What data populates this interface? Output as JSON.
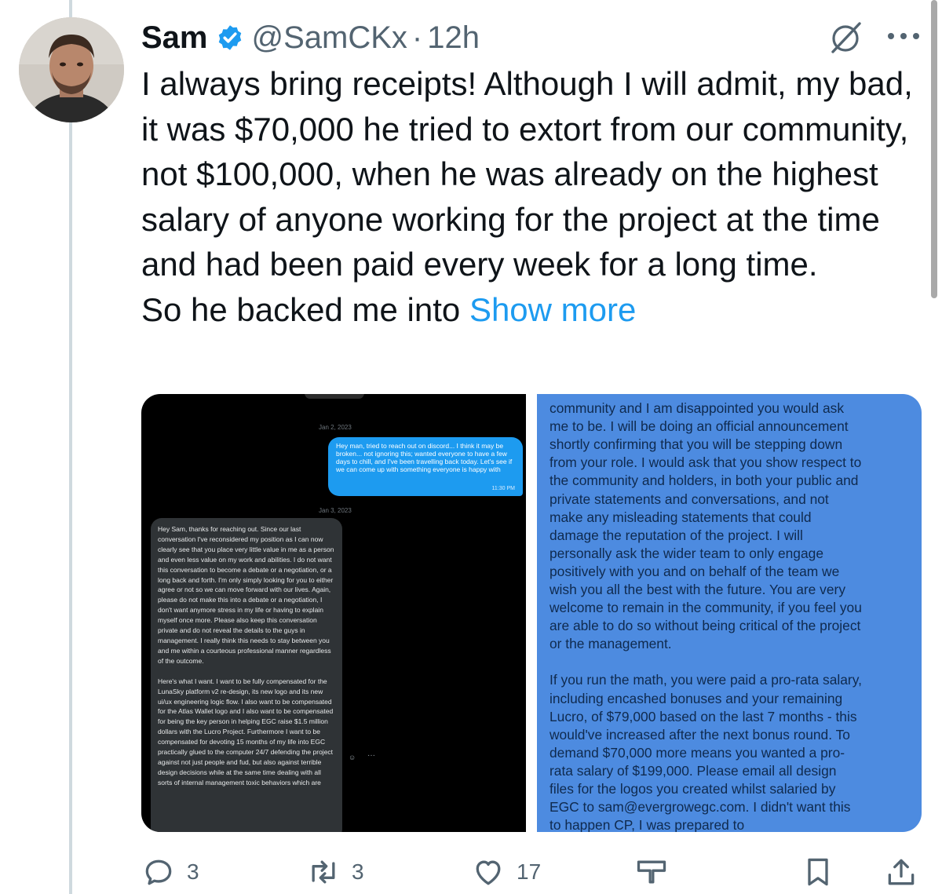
{
  "author": {
    "name": "Sam",
    "handle": "@SamCKx",
    "separator": "·",
    "time": "12h"
  },
  "icons": {
    "verified": "verified-badge-icon",
    "grok": "grok-icon",
    "more": "more-options-icon"
  },
  "tweet": {
    "paragraph_1": "I always bring receipts! Although I will admit, my bad, it was $70,000 he tried to extort from our community, not $100,000, when he was already on the highest salary of anyone working for the project at the time and had been paid every week for a long time.",
    "paragraph_2_text": "So he backed me into",
    "show_more": "Show more"
  },
  "media": {
    "left": {
      "date_1": "Jan 2, 2023",
      "sent_message": "Hey man, tried to reach out on discord... I think it may be broken... not ignoring this; wanted everyone to have a few days to chill, and I've been travelling back today. Let's see if we can come up with something everyone is happy with",
      "sent_time": "11:30 PM",
      "date_2": "Jan 3, 2023",
      "received_paragraph_1": "Hey Sam, thanks for reaching out. Since our last conversation I've reconsidered my position as I can now clearly see that you place very little value in me as a person and even less value on my work and abilities. I do not want this conversation to become a debate or a negotiation, or a long back and forth. I'm only simply looking for you to either agree or not so we can move forward with our lives. Again, please do not make this into a debate or a negotiation, I don't want anymore stress in my life or having to explain myself once more. Please also keep this conversation private and do not reveal the details to the guys in management. I really think this needs to stay between you and me within a courteous professional manner regardless of the outcome.",
      "received_paragraph_2": "Here's what I want. I want to be fully compensated for the LunaSky platform v2 re-design, its new logo and its new ui/ux engineering logic flow. I also want to be compensated for the Atlas Wallet logo and I also want to be compensated for being the key person in helping EGC raise $1.5 million dollars with the Lucro Project. Furthermore I want to be compensated for devoting 15 months of my life into EGC practically glued to the computer 24/7 defending the project against not just people and fud, but also against terrible design decisions while at the same time dealing with all sorts of internal management toxic behaviors which are"
    },
    "right": {
      "paragraph_1": "community and I am disappointed you would ask me to be.  I will be doing an official announcement shortly confirming that you will be stepping down from your role. I would ask that you show respect to the community and holders, in both your public and private statements and conversations, and not make any misleading statements that could damage the reputation of the project. I will personally ask the wider team to only engage positively with you and on behalf of the team we wish you all the best with the future. You are very welcome to remain in the community, if you feel you are able to do so without being critical of the project or the management.",
      "paragraph_2": "If you run the math, you were paid a pro-rata salary, including encashed bonuses and your remaining Lucro, of $79,000 based on the last 7 months - this would've increased after the next bonus round. To demand $70,000 more means you wanted a pro-rata salary of $199,000. Please email all design files for the logos you created whilst salaried by EGC to sam@evergrowegc.com. I didn't want this to happen CP, I was prepared to"
    }
  },
  "actions": {
    "reply_count": "3",
    "retweet_count": "3",
    "like_count": "17",
    "views_count": "",
    "colors": {
      "icon": "#536471",
      "accent": "#1d9bf0"
    }
  }
}
